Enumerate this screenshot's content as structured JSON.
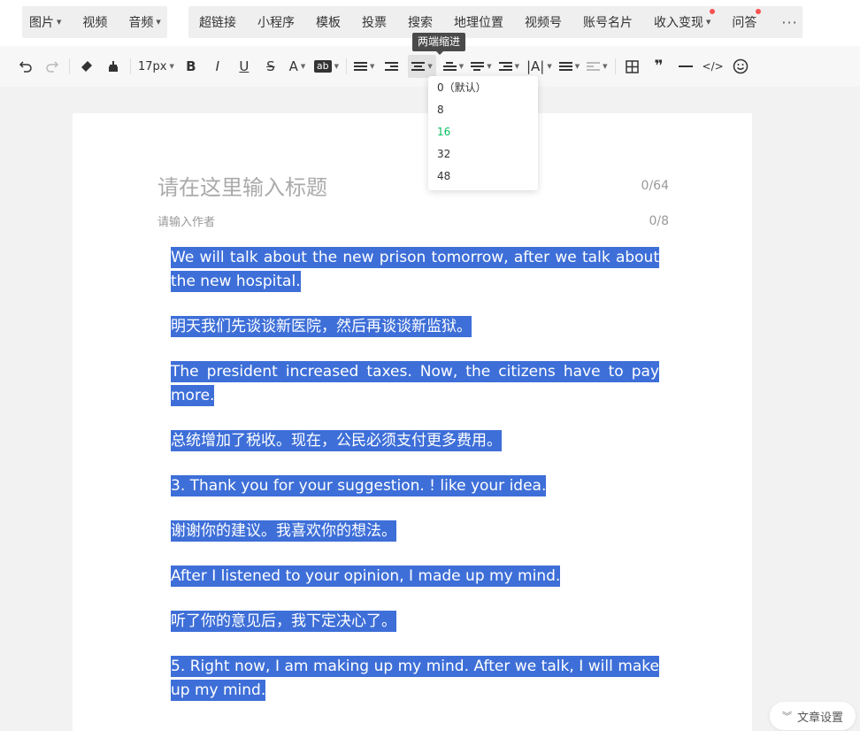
{
  "topbar": {
    "group1": [
      {
        "label": "图片",
        "dropdown": true
      },
      {
        "label": "视频",
        "dropdown": false
      },
      {
        "label": "音频",
        "dropdown": true
      }
    ],
    "group2": [
      {
        "label": "超链接",
        "dropdown": false,
        "dot": false
      },
      {
        "label": "小程序",
        "dropdown": false,
        "dot": false
      },
      {
        "label": "模板",
        "dropdown": false,
        "dot": false
      },
      {
        "label": "投票",
        "dropdown": false,
        "dot": false
      },
      {
        "label": "搜索",
        "dropdown": false,
        "dot": false
      },
      {
        "label": "地理位置",
        "dropdown": false,
        "dot": false
      },
      {
        "label": "视频号",
        "dropdown": false,
        "dot": false
      },
      {
        "label": "账号名片",
        "dropdown": false,
        "dot": false
      },
      {
        "label": "收入变现",
        "dropdown": true,
        "dot": true
      },
      {
        "label": "问答",
        "dropdown": false,
        "dot": true
      }
    ],
    "more_label": "···",
    "dot_color": "#fa5151"
  },
  "toolbar": {
    "font_size": "17px",
    "bold": "B",
    "italic": "I",
    "underline": "U",
    "strike": "S",
    "font_color": "A",
    "bg_color": "ab",
    "letter_spacing": "|A|",
    "quote": "❞",
    "code": "</>"
  },
  "tooltip": "两端缩进",
  "indent_dropdown": {
    "options": [
      "0（默认）",
      "8",
      "16",
      "32",
      "48"
    ],
    "selected": "16",
    "selected_color": "#07c160"
  },
  "editor": {
    "title_placeholder": "请在这里输入标题",
    "title_count": "0/64",
    "author_placeholder": "请输入作者",
    "author_count": "0/8",
    "selection_color": "#3e6fd8",
    "paragraphs": [
      "We will talk about the new prison tomorrow, after we talk about the new hospital.",
      "明天我们先谈谈新医院，然后再谈谈新监狱。",
      "The president increased taxes. Now, the citizens have to pay more.",
      "总统增加了税收。现在，公民必须支付更多费用。",
      "3. Thank you for your suggestion. ! like your idea.",
      "谢谢你的建议。我喜欢你的想法。",
      "After I listened to your opinion, I made up my mind.",
      "听了你的意见后，我下定决心了。",
      "5. Right now, I am making up my mind. After we talk, I will make up my mind."
    ]
  },
  "settings_label": "文章设置"
}
